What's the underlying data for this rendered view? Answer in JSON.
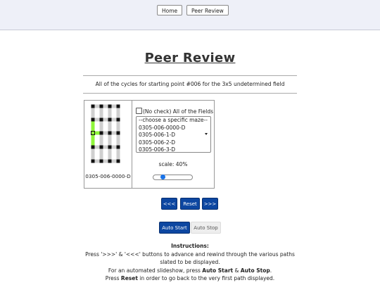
{
  "nav": {
    "home_label": "Home",
    "peer_review_label": "Peer Review"
  },
  "page": {
    "title": "Peer Review",
    "subtitle": "All of the cycles for starting point #006 for the 3x5 undetermined field"
  },
  "maze": {
    "label": "0305-006-0000-D",
    "colors": {
      "track": "#cfcfcf",
      "node": "#111111",
      "path": "#8ff53a"
    }
  },
  "controls": {
    "no_check_label": "(No check) All of the Fields",
    "select_options": [
      "--choose a specific maze--",
      "0305-006-0000-D",
      "0305-006-1-D",
      "0305-006-2-D",
      "0305-006-3-D"
    ],
    "scale_label": "scale: 40%",
    "scale_value": 0.4
  },
  "buttons": {
    "prev": "<<<",
    "reset": "Reset",
    "next": ">>>",
    "auto_start": "Auto Start",
    "auto_stop": "Auto Stop"
  },
  "instructions": {
    "heading": "Instructions:",
    "line1": "Press '>>>' & '<<<' buttons to advance and rewind through the various paths slated to be displayed.",
    "line2_pre": "For an automated slideshow, press ",
    "line2_b1": "Auto Start",
    "line2_mid": " & ",
    "line2_b2": "Auto Stop",
    "line2_post": ".",
    "line3_pre": "Press ",
    "line3_b": "Reset",
    "line3_post": " in order to go back to the very first path displayed."
  }
}
